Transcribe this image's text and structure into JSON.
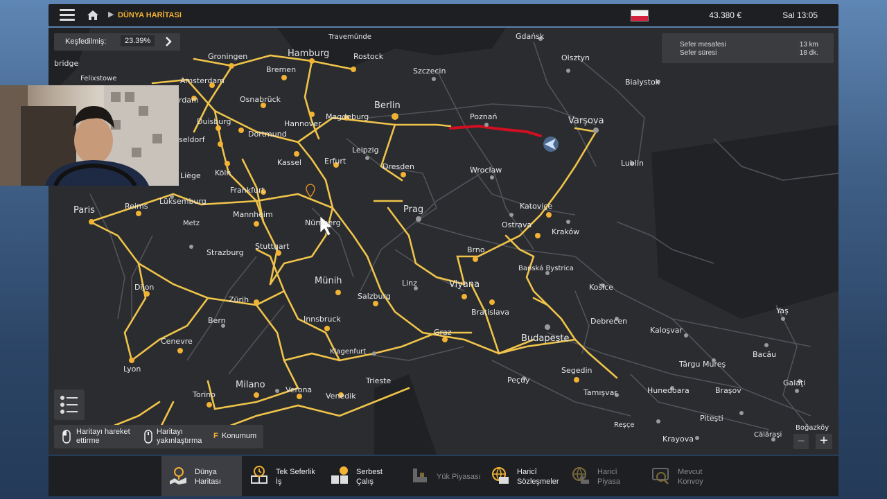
{
  "topbar": {
    "breadcrumb": "DÜNYA HARİTASI",
    "money": "43.380 €",
    "clock": "Sal 13:05",
    "flag_colors": [
      "#f4f4f4",
      "#d4213d"
    ]
  },
  "explored": {
    "label": "Keşfedilmiş:",
    "value": "23.39%"
  },
  "trip": {
    "distance_label": "Sefer mesafesi",
    "distance_value": "13 km",
    "duration_label": "Sefer süresi",
    "duration_value": "18 dk."
  },
  "hints": {
    "move": "Haritayı hareket\nettirme",
    "zoom": "Haritayı\nyakınlaştırma",
    "locate_key": "F",
    "locate": "Konumum"
  },
  "zoom": {
    "minus": "−",
    "plus": "+"
  },
  "cities": {
    "travemunde": "Travemünde",
    "gdansk": "Gdańsk",
    "bridge": "bridge",
    "felixstowe": "Felixstowe",
    "groningen": "Groningen",
    "hamburg": "Hamburg",
    "rostock": "Rostock",
    "olsztyn": "Olsztyn",
    "bremen": "Bremen",
    "szczecin": "Szczecin",
    "bialystok": "Bialystok",
    "amsterdam": "Amsterdam",
    "rdam": "rdam",
    "osnabruck": "Osnabrück",
    "berlin": "Berlin",
    "magdeburg": "Magdeburg",
    "poznan": "Poznań",
    "varsova": "Varşova",
    "hannover": "Hannover",
    "duisburg": "Duisburg",
    "dortmund": "Dortmund",
    "seldorf": "seldorf",
    "leipzig": "Leipzig",
    "kassel": "Kassel",
    "erfurt": "Erfurt",
    "dresden": "Dresden",
    "wroclaw": "Wrocław",
    "lublin": "Lublin",
    "koln": "Köln",
    "liege": "Liège",
    "frankfurt": "Frankfurt",
    "luksemburg": "Lüksemburg",
    "katovice": "Katoviçe",
    "prag": "Prag",
    "paris": "Paris",
    "reims": "Reims",
    "mannheim": "Mannheim",
    "metz": "Metz",
    "nurnberg": "Nürnberg",
    "ostrava": "Ostrava",
    "krakow": "Kraków",
    "stuttgart": "Stuttgart",
    "strazburg": "Strazburg",
    "brno": "Brno",
    "banska": "Banská Bystrica",
    "dijon": "Dijon",
    "munih": "Münih",
    "linz": "Linz",
    "viyana": "Viyana",
    "kosice": "Košice",
    "zurih": "Zürih",
    "salzburg": "Salzburg",
    "bratislava": "Bratislava",
    "debrecen": "Debrecen",
    "yas": "Yaş",
    "bern": "Bern",
    "innsbruck": "Innsbruck",
    "kalosvar": "Kaloşvar",
    "graz": "Graz",
    "budapeste": "Budapeşte",
    "cenevre": "Cenevre",
    "klagenfurt": "Klagenfurt",
    "targu": "Târgu Mureş",
    "bacau": "Bacău",
    "lyon": "Lyon",
    "segedin": "Segedin",
    "trieste": "Trieste",
    "pecuy": "Peçuy",
    "galati": "Galaţi",
    "milano": "Milano",
    "verona": "Verona",
    "tamisvar": "Tamışvar",
    "hunedoara": "Hunedoara",
    "brasov": "Braşov",
    "torino": "Torino",
    "venedik": "Venedik",
    "pitesti": "Piteşti",
    "resce": "Reşçe",
    "bogazkoy": "Boğazköy",
    "krayova": "Krayova",
    "calarasi": "Călăraşi"
  },
  "nav": [
    {
      "label": "Dünya\nHaritası",
      "icon": "world-map-icon"
    },
    {
      "label": "Tek Seferlik\nİş",
      "icon": "clock-box-icon"
    },
    {
      "label": "Serbest\nÇalış",
      "icon": "cargo-icon"
    },
    {
      "label": "Yük Piyasası",
      "icon": "freight-market-icon"
    },
    {
      "label": "Haricî\nSözleşmeler",
      "icon": "globe-contract-icon"
    },
    {
      "label": "Haricî\nPiyasa",
      "icon": "globe-market-icon"
    },
    {
      "label": "Mevcut\nKonvoy",
      "icon": "convoy-icon"
    }
  ],
  "colors": {
    "accent": "#f2b233",
    "road": "#f0c44a",
    "route": "#d01020",
    "map_bg": "#25272b"
  }
}
